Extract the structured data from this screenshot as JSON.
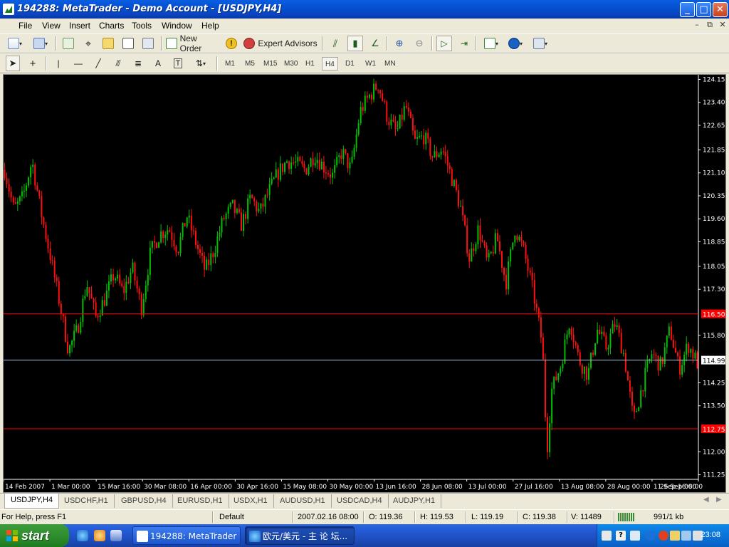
{
  "window": {
    "title": "194288: MetaTrader - Demo Account - [USDJPY,H4]",
    "controls": [
      "_",
      "□",
      "✕"
    ]
  },
  "menu": {
    "items": [
      "File",
      "View",
      "Insert",
      "Charts",
      "Tools",
      "Window",
      "Help"
    ],
    "mdi_controls": [
      "–",
      "⧉",
      "✕"
    ]
  },
  "toolbar": {
    "new_order_label": "New Order",
    "expert_advisors_label": "Expert Advisors"
  },
  "timeframes": {
    "items": [
      "M1",
      "M5",
      "M15",
      "M30",
      "H1",
      "H4",
      "D1",
      "W1",
      "MN"
    ],
    "active": "H4"
  },
  "chart_tabs": {
    "items": [
      "USDJPY,H4",
      "USDCHF,H1",
      "GBPUSD,H4",
      "EURUSD,H1",
      "USDX,H1",
      "AUDUSD,H1",
      "USDCAD,H4",
      "AUDJPY,H1"
    ],
    "active": "USDJPY,H4"
  },
  "status": {
    "help": "For Help, press F1",
    "profile": "Default",
    "datetime": "2007.02.16 08:00",
    "open": "O: 119.36",
    "high": "H: 119.53",
    "low": "L: 119.19",
    "close": "C: 119.38",
    "volume": "V: 11489",
    "traffic": "991/1 kb"
  },
  "taskbar": {
    "start_label": "start",
    "tasks": [
      "194288: MetaTrader ...",
      "欧元/美元 - 主 论 坛..."
    ],
    "clock": "23:08"
  },
  "colors": {
    "bull": "#00c000",
    "bear": "#ff1010",
    "hline": "#ff0000",
    "bid_line": "#b0c4de",
    "chart_bg": "#000000",
    "axis_text": "#ffffff"
  },
  "chart_data": {
    "type": "candlestick",
    "symbol": "USDJPY",
    "timeframe": "H4",
    "y_ticks": [
      124.15,
      123.4,
      122.65,
      121.85,
      121.1,
      120.35,
      119.6,
      118.85,
      118.05,
      117.3,
      116.5,
      115.8,
      114.99,
      114.25,
      113.5,
      112.75,
      112.0,
      111.25
    ],
    "y_tick_labels": [
      "124.15",
      "123.40",
      "122.65",
      "121.85",
      "121.10",
      "120.35",
      "119.60",
      "118.85",
      "118.05",
      "117.30",
      "115.80",
      "114.25",
      "113.50",
      "112.00",
      "111.25"
    ],
    "ylim": [
      111.1,
      124.3
    ],
    "x_tick_labels": [
      "14 Feb 2007",
      "1 Mar 00:00",
      "15 Mar 16:00",
      "30 Mar 08:00",
      "16 Apr 00:00",
      "30 Apr 16:00",
      "15 May 08:00",
      "30 May 00:00",
      "13 Jun 16:00",
      "28 Jun 08:00",
      "13 Jul 00:00",
      "27 Jul 16:00",
      "13 Aug 08:00",
      "28 Aug 00:00",
      "11 Sep 16:00",
      "26 Sep 08:00"
    ],
    "horizontal_lines": [
      {
        "price": 116.5,
        "label": "116.50",
        "color": "#ff0000"
      },
      {
        "price": 112.75,
        "label": "112.75",
        "color": "#ff0000"
      }
    ],
    "bid_line": {
      "price": 114.99,
      "label": "114.99"
    },
    "close_path": [
      [
        0,
        121.2
      ],
      [
        4,
        119.9
      ],
      [
        8,
        120.3
      ],
      [
        12,
        121.5
      ],
      [
        16,
        119.8
      ],
      [
        20,
        118.4
      ],
      [
        24,
        116.9
      ],
      [
        28,
        115.3
      ],
      [
        32,
        116.0
      ],
      [
        36,
        117.5
      ],
      [
        40,
        116.4
      ],
      [
        44,
        117.0
      ],
      [
        48,
        117.8
      ],
      [
        52,
        117.2
      ],
      [
        56,
        118.0
      ],
      [
        60,
        116.7
      ],
      [
        64,
        118.5
      ],
      [
        68,
        119.1
      ],
      [
        72,
        119.3
      ],
      [
        76,
        118.6
      ],
      [
        80,
        119.7
      ],
      [
        84,
        118.8
      ],
      [
        88,
        117.9
      ],
      [
        92,
        118.6
      ],
      [
        96,
        119.6
      ],
      [
        100,
        120.0
      ],
      [
        104,
        119.4
      ],
      [
        108,
        120.3
      ],
      [
        112,
        119.8
      ],
      [
        116,
        120.5
      ],
      [
        120,
        121.1
      ],
      [
        124,
        121.5
      ],
      [
        128,
        121.4
      ],
      [
        132,
        121.2
      ],
      [
        136,
        121.7
      ],
      [
        140,
        121.3
      ],
      [
        144,
        121.0
      ],
      [
        148,
        121.8
      ],
      [
        152,
        121.2
      ],
      [
        156,
        123.1
      ],
      [
        160,
        123.6
      ],
      [
        164,
        124.0
      ],
      [
        168,
        122.9
      ],
      [
        172,
        122.4
      ],
      [
        176,
        123.3
      ],
      [
        180,
        122.1
      ],
      [
        184,
        122.3
      ],
      [
        188,
        121.6
      ],
      [
        192,
        121.9
      ],
      [
        196,
        121.0
      ],
      [
        200,
        120.0
      ],
      [
        204,
        118.3
      ],
      [
        208,
        119.3
      ],
      [
        212,
        118.1
      ],
      [
        216,
        119.0
      ],
      [
        220,
        117.5
      ],
      [
        224,
        119.3
      ],
      [
        228,
        118.5
      ],
      [
        232,
        117.2
      ],
      [
        236,
        115.5
      ],
      [
        238,
        112.0
      ],
      [
        240,
        114.0
      ],
      [
        244,
        114.8
      ],
      [
        248,
        116.3
      ],
      [
        252,
        115.0
      ],
      [
        256,
        114.5
      ],
      [
        260,
        116.0
      ],
      [
        264,
        115.4
      ],
      [
        268,
        116.2
      ],
      [
        272,
        115.1
      ],
      [
        276,
        113.0
      ],
      [
        280,
        114.2
      ],
      [
        284,
        115.2
      ],
      [
        288,
        114.8
      ],
      [
        292,
        116.0
      ],
      [
        296,
        114.7
      ],
      [
        300,
        115.5
      ],
      [
        304,
        114.9
      ]
    ]
  }
}
